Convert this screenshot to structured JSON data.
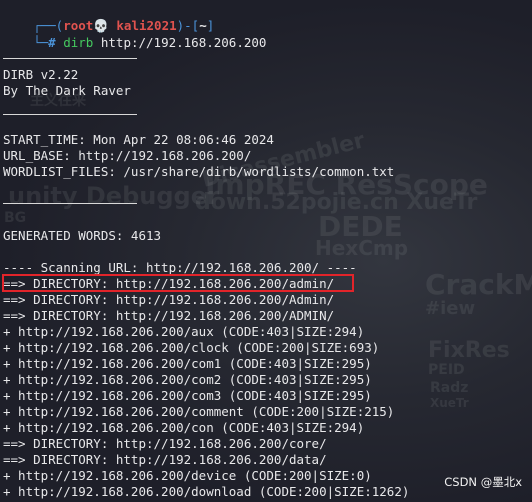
{
  "prompt": {
    "open": "┌──(",
    "user_host": "root💀 kali2021",
    "close_mid": ")-[",
    "path": "~",
    "close": "]",
    "second_line_prefix": "└─",
    "dollar": "#",
    "command_name": "dirb",
    "command_args": " http://192.168.206.200"
  },
  "banner": {
    "title": "DIRB v2.22",
    "author": "By The Dark Raver"
  },
  "info": {
    "start_time": "START_TIME: Mon Apr 22 08:06:46 2024",
    "url_base": "URL_BASE: http://192.168.206.200/",
    "wordlist": "WORDLIST_FILES: /usr/share/dirb/wordlists/common.txt"
  },
  "generated": "GENERATED WORDS: 4613",
  "scanning": "---- Scanning URL: http://192.168.206.200/ ----",
  "results": [
    "==> DIRECTORY: http://192.168.206.200/admin/",
    "==> DIRECTORY: http://192.168.206.200/Admin/",
    "==> DIRECTORY: http://192.168.206.200/ADMIN/",
    "+ http://192.168.206.200/aux (CODE:403|SIZE:294)",
    "+ http://192.168.206.200/clock (CODE:200|SIZE:693)",
    "+ http://192.168.206.200/com1 (CODE:403|SIZE:295)",
    "+ http://192.168.206.200/com2 (CODE:403|SIZE:295)",
    "+ http://192.168.206.200/com3 (CODE:403|SIZE:295)",
    "+ http://192.168.206.200/comment (CODE:200|SIZE:215)",
    "+ http://192.168.206.200/con (CODE:403|SIZE:294)",
    "==> DIRECTORY: http://192.168.206.200/core/",
    "==> DIRECTORY: http://192.168.206.200/data/",
    "+ http://192.168.206.200/device (CODE:200|SIZE:0)",
    "+ http://192.168.206.200/download (CODE:200|SIZE:1262)"
  ],
  "caption": "CSDN @墨北x",
  "colors": {
    "background": "#1e1f29",
    "text": "#e8e8ea",
    "prompt_blue": "#4b93d9",
    "prompt_red": "#e0534f",
    "command_green": "#45c95f",
    "highlight_red": "#e2242a"
  }
}
